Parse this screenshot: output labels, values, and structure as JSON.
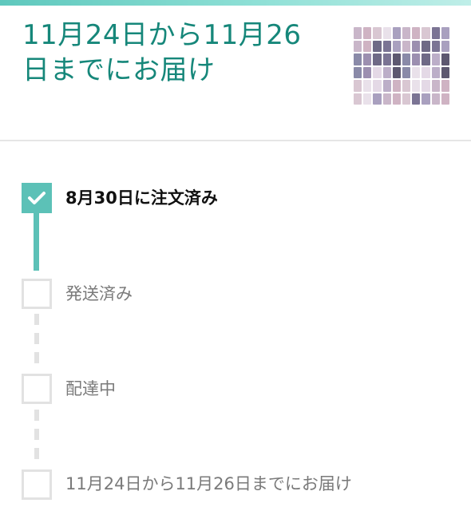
{
  "header": {
    "delivery_title": "11月24日から11月26日までにお届け",
    "product_thumbnail": "product-image"
  },
  "steps": [
    {
      "label": "8月30日に注文済み",
      "status": "completed"
    },
    {
      "label": "発送済み",
      "status": "pending"
    },
    {
      "label": "配達中",
      "status": "pending"
    },
    {
      "label": "11月24日から11月26日までにお届け",
      "status": "pending"
    }
  ],
  "colors": {
    "accent": "#16877a",
    "progress": "#5cc1b7",
    "inactive": "#e2e2e2"
  }
}
